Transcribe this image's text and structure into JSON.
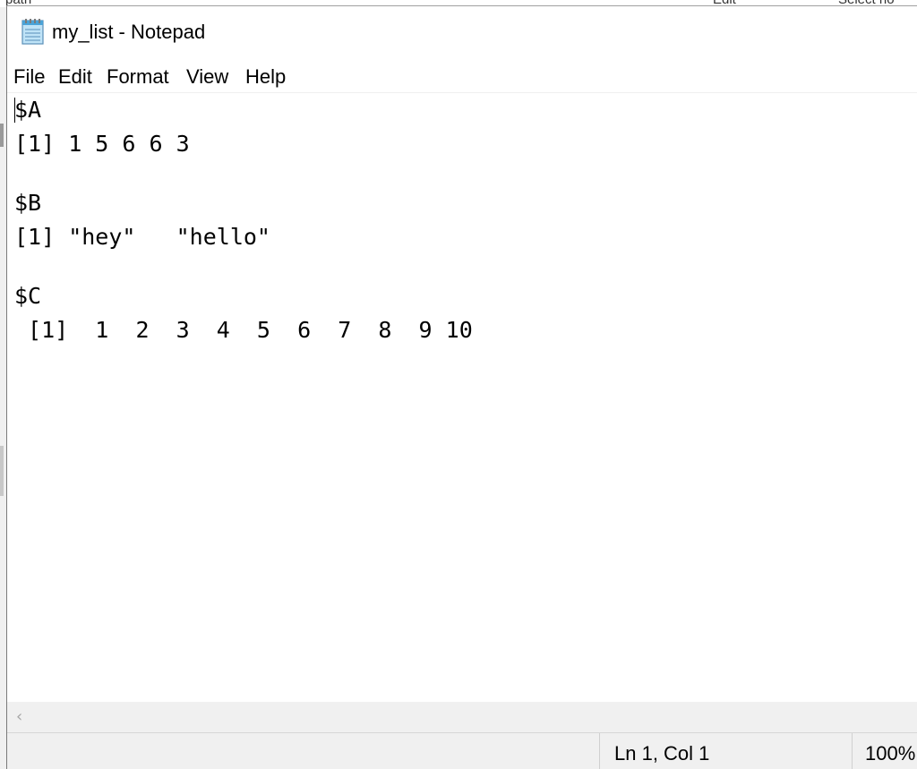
{
  "background_app": {
    "fragments": [
      "path",
      "Edit",
      "Select no"
    ]
  },
  "window": {
    "title": "my_list - Notepad",
    "icon": "notepad-icon"
  },
  "menu": {
    "items": [
      "File",
      "Edit",
      "Format",
      "View",
      "Help"
    ]
  },
  "editor": {
    "lines": [
      "$A",
      "[1] 1 5 6 6 3",
      "",
      "$B",
      "[1] \"hey\"   \"hello\"",
      "",
      "$C",
      " [1]  1  2  3  4  5  6  7  8  9 10"
    ]
  },
  "scrollbar": {
    "left_arrow_icon": "chevron-left-icon"
  },
  "status": {
    "position": "Ln 1, Col 1",
    "zoom": "100%"
  },
  "colors": {
    "chrome": "#f0f0f0",
    "text": "#000000",
    "editor_bg": "#ffffff"
  }
}
